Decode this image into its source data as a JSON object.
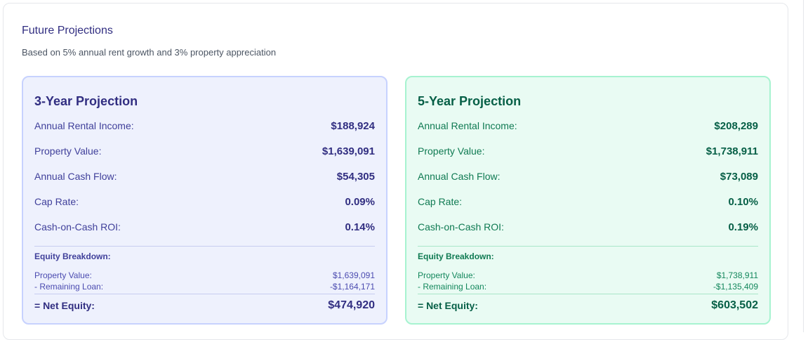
{
  "header": {
    "title": "Future Projections",
    "subtitle": "Based on 5% annual rent growth and 3% property appreciation"
  },
  "cards": [
    {
      "title": "3-Year Projection",
      "rows": [
        {
          "label": "Annual Rental Income:",
          "value": "$188,924"
        },
        {
          "label": "Property Value:",
          "value": "$1,639,091"
        },
        {
          "label": "Annual Cash Flow:",
          "value": "$54,305"
        },
        {
          "label": "Cap Rate:",
          "value": "0.09%"
        },
        {
          "label": "Cash-on-Cash ROI:",
          "value": "0.14%"
        }
      ],
      "equity": {
        "heading": "Equity Breakdown:",
        "property_label": "Property Value:",
        "property_value": "$1,639,091",
        "loan_label": "- Remaining Loan:",
        "loan_value": "-$1,164,171",
        "net_label": "= Net Equity:",
        "net_value": "$474,920"
      }
    },
    {
      "title": "5-Year Projection",
      "rows": [
        {
          "label": "Annual Rental Income:",
          "value": "$208,289"
        },
        {
          "label": "Property Value:",
          "value": "$1,738,911"
        },
        {
          "label": "Annual Cash Flow:",
          "value": "$73,089"
        },
        {
          "label": "Cap Rate:",
          "value": "0.10%"
        },
        {
          "label": "Cash-on-Cash ROI:",
          "value": "0.19%"
        }
      ],
      "equity": {
        "heading": "Equity Breakdown:",
        "property_label": "Property Value:",
        "property_value": "$1,738,911",
        "loan_label": "- Remaining Loan:",
        "loan_value": "-$1,135,409",
        "net_label": "= Net Equity:",
        "net_value": "$603,502"
      }
    }
  ],
  "colors": {
    "three_year_bg": "#eef1fd",
    "three_year_border": "#c7d2fe",
    "five_year_bg": "#e9fbf3",
    "five_year_border": "#a7f3d0"
  }
}
